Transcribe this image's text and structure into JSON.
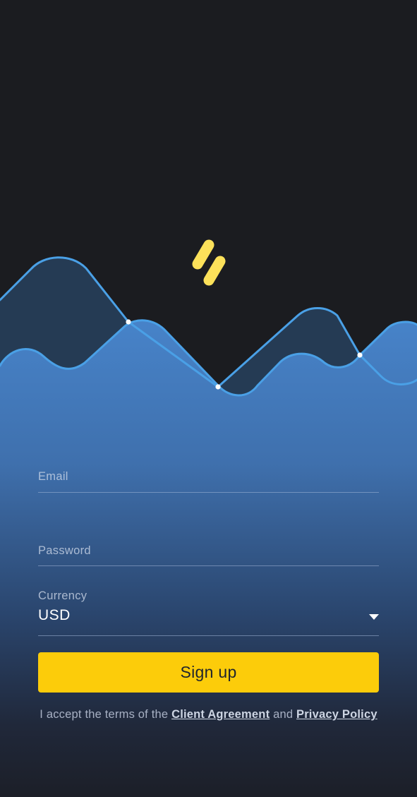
{
  "colors": {
    "background": "#1b1c20",
    "accent_yellow": "#fccc0a",
    "wave_line": "#4aa0e6",
    "gradient_top": "#4783c9",
    "gradient_bottom": "#1e2130"
  },
  "logo": {
    "icon": "two-stripes-logo-icon"
  },
  "form": {
    "email": {
      "label": "Email",
      "value": ""
    },
    "password": {
      "label": "Password",
      "value": ""
    },
    "currency": {
      "label": "Currency",
      "selected": "USD",
      "icon": "chevron-down-icon"
    },
    "signup_button": "Sign up",
    "terms": {
      "prefix": "I accept the terms of the ",
      "client_agreement": "Client Agreement",
      "middle": " and ",
      "privacy_policy": "Privacy Policy"
    }
  }
}
